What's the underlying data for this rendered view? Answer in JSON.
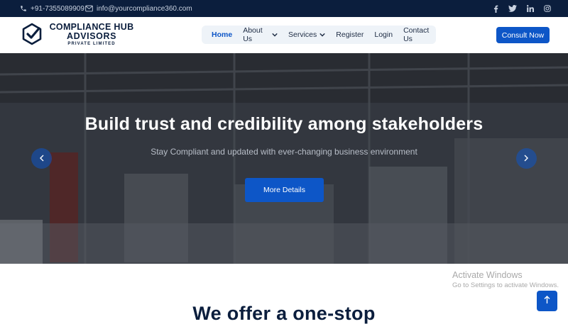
{
  "topbar": {
    "phone": "+91-7355089909",
    "email": "info@yourcompliance360.com",
    "social": [
      {
        "icon": "facebook-icon",
        "glyph": "f"
      },
      {
        "icon": "twitter-icon",
        "glyph": "t"
      },
      {
        "icon": "linkedin-icon",
        "glyph": "in"
      },
      {
        "icon": "instagram-icon",
        "glyph": "ig"
      }
    ]
  },
  "brand": {
    "line1": "COMPLIANCE HUB",
    "line2": "ADVISORS",
    "line3": "PRIVATE LIMITED"
  },
  "nav": {
    "items": [
      {
        "label": "Home",
        "active": true,
        "dropdown": false
      },
      {
        "label": "About Us",
        "active": false,
        "dropdown": true
      },
      {
        "label": "Services",
        "active": false,
        "dropdown": true
      },
      {
        "label": "Register",
        "active": false,
        "dropdown": false
      },
      {
        "label": "Login",
        "active": false,
        "dropdown": false
      },
      {
        "label": "Contact Us",
        "active": false,
        "dropdown": false
      }
    ],
    "cta_label": "Consult Now"
  },
  "hero": {
    "title": "Build trust and credibility among stakeholders",
    "subtitle": "Stay Compliant and updated with ever-changing business environment",
    "button_label": "More Details"
  },
  "watermark": {
    "line1": "Activate Windows",
    "line2": "Go to Settings to activate Windows."
  },
  "section": {
    "title": "We offer a one-stop"
  },
  "colors": {
    "topbar_bg": "#0b1e3d",
    "primary": "#0d56c7",
    "nav_bg": "#eef3f8",
    "heading": "#0b1e3d"
  }
}
